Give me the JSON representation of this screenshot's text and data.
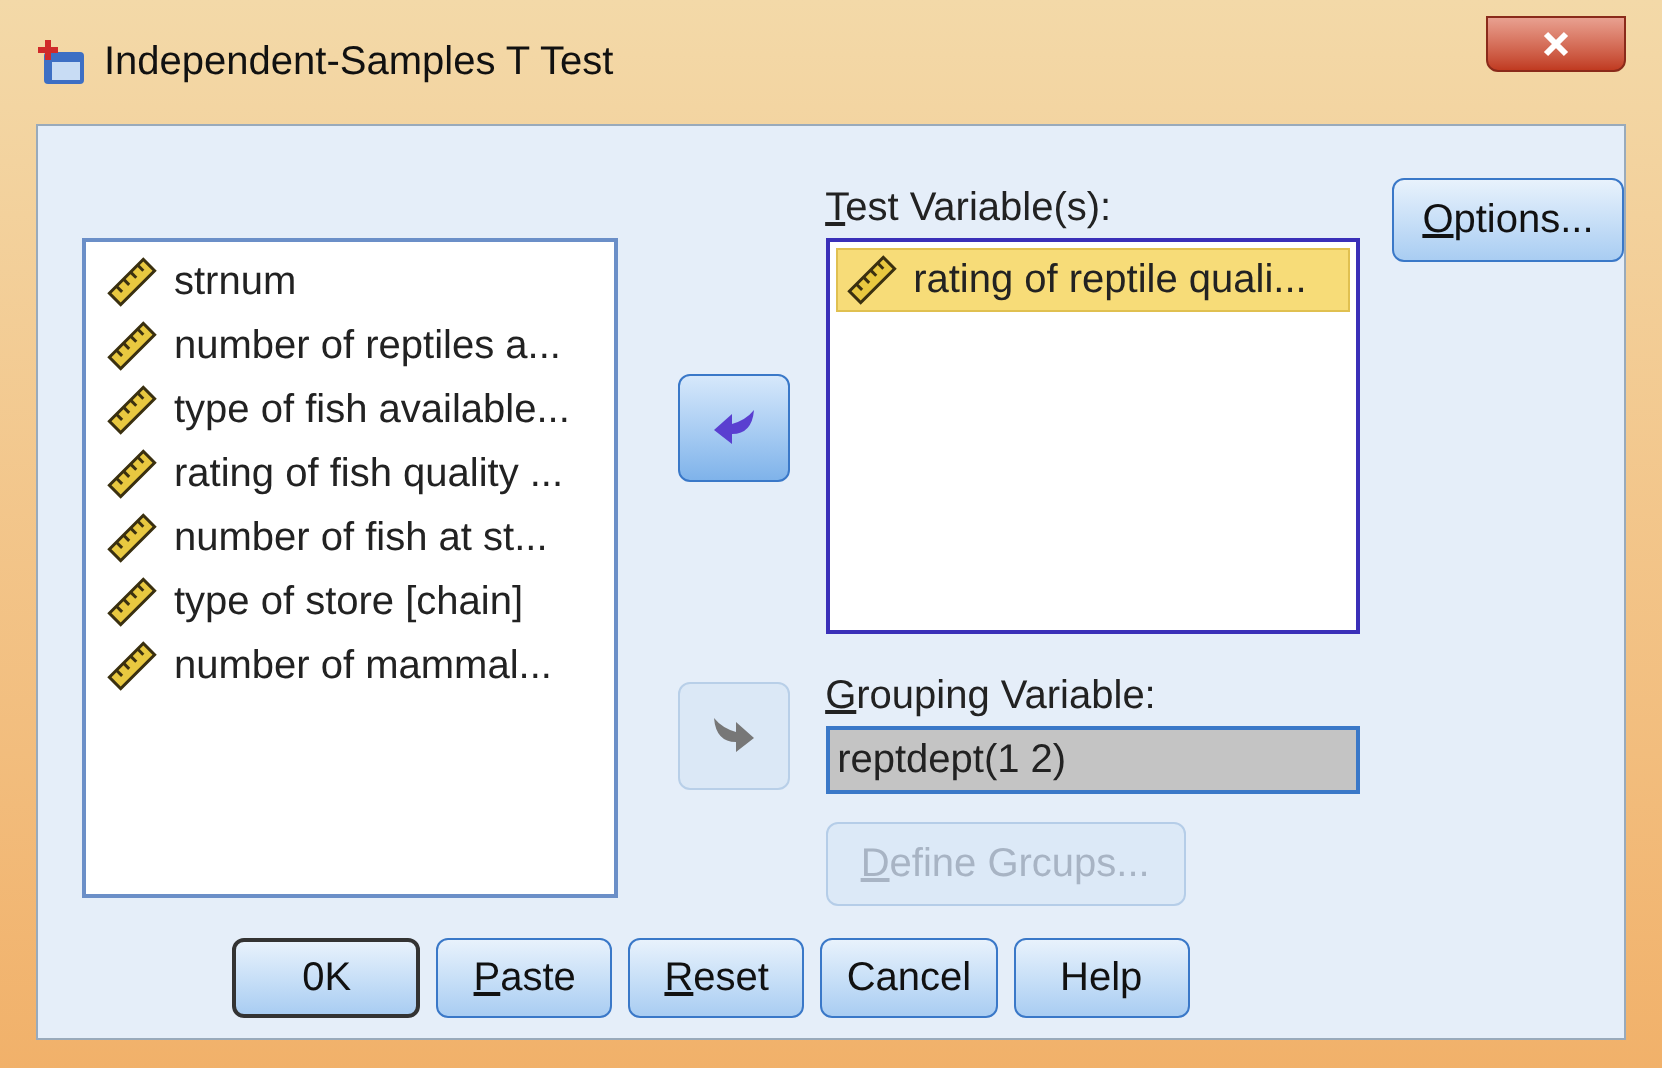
{
  "window": {
    "title": "Independent-Samples T Test"
  },
  "source_list": {
    "items": [
      {
        "label": "strnum",
        "selected": false
      },
      {
        "label": "number of reptiles a...",
        "selected": false
      },
      {
        "label": "type of fish available...",
        "selected": false
      },
      {
        "label": "rating of fish quality ...",
        "selected": false
      },
      {
        "label": "number of fish at st...",
        "selected": false
      },
      {
        "label": "type of store [chain]",
        "selected": false
      },
      {
        "label": "number of mammal...",
        "selected": false
      }
    ]
  },
  "move_buttons": [
    {
      "disabled": false
    },
    {
      "disabled": true
    }
  ],
  "test_variables": {
    "label": "Test Variable(s):",
    "underlined": true,
    "items": [
      {
        "label": "rating of reptile quali...",
        "selected": true
      }
    ]
  },
  "grouping_variable": {
    "label": "Grouping Variable:",
    "underlined": true,
    "value": "reptdept(1 2)"
  },
  "define_groups": {
    "label": "Define Grcups...",
    "underlined": true,
    "disabled": true
  },
  "options_button": {
    "label": "Options...",
    "underlined": true,
    "disabled": false
  },
  "buttons": [
    {
      "label": "0K",
      "underlined": false,
      "default": true
    },
    {
      "label": "Paste",
      "underlined": true,
      "default": false
    },
    {
      "label": "Reset",
      "underlined": true,
      "default": false
    },
    {
      "label": "Cancel",
      "underlined": false,
      "default": false
    },
    {
      "label": "Help",
      "underlined": false,
      "default": false
    }
  ]
}
